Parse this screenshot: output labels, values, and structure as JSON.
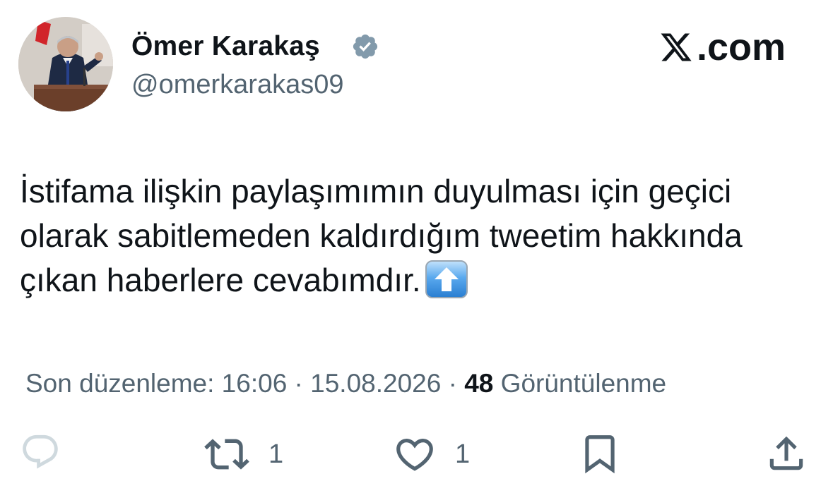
{
  "author": {
    "name": "Ömer Karakaş",
    "handle": "@omerkarakas09",
    "verified_icon": "verified-badge-icon"
  },
  "brand": {
    "label": ".com",
    "logo_icon": "x-logo-icon"
  },
  "tweet": {
    "text": "İstifama ilişkin paylaşımımın duyulması için geçici olarak sabitlemeden kaldırdığım tweetim hakkında çıkan haberlere cevabımdır.",
    "emoji": "up-arrow-emoji"
  },
  "meta": {
    "edited_prefix": "Son düzenleme: 16:06 · 15.08.2026",
    "separator": " · ",
    "views_count": "48",
    "views_label": "Görüntülenme"
  },
  "actions": {
    "reply": {
      "icon": "reply-icon",
      "count": ""
    },
    "retweet": {
      "icon": "retweet-icon",
      "count": "1"
    },
    "like": {
      "icon": "heart-icon",
      "count": "1"
    },
    "bookmark": {
      "icon": "bookmark-icon"
    },
    "share": {
      "icon": "share-icon"
    }
  },
  "colors": {
    "text": "#0f1419",
    "muted": "#536471",
    "verified": "#829aab",
    "bg": "#ffffff"
  }
}
